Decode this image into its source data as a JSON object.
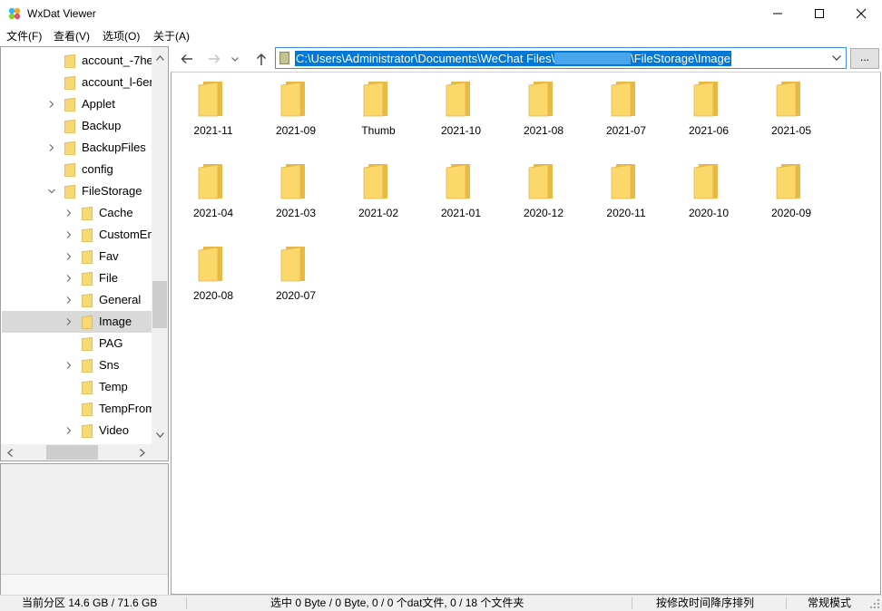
{
  "window": {
    "title": "WxDat Viewer",
    "minimize_icon": "minimize-icon",
    "maximize_icon": "maximize-icon",
    "close_icon": "close-icon"
  },
  "menu": [
    "文件(F)",
    "查看(V)",
    "选项(O)",
    "关于(A)"
  ],
  "tree": {
    "items": [
      {
        "label": "account_-7he",
        "level": 1,
        "expander": "none",
        "selected": false
      },
      {
        "label": "account_l-6er",
        "level": 1,
        "expander": "none",
        "selected": false
      },
      {
        "label": "Applet",
        "level": 1,
        "expander": "collapsed",
        "selected": false
      },
      {
        "label": "Backup",
        "level": 1,
        "expander": "none",
        "selected": false
      },
      {
        "label": "BackupFiles",
        "level": 1,
        "expander": "collapsed",
        "selected": false
      },
      {
        "label": "config",
        "level": 1,
        "expander": "none",
        "selected": false
      },
      {
        "label": "FileStorage",
        "level": 1,
        "expander": "expanded",
        "selected": false
      },
      {
        "label": "Cache",
        "level": 2,
        "expander": "collapsed",
        "selected": false
      },
      {
        "label": "CustomEm",
        "level": 2,
        "expander": "collapsed",
        "selected": false
      },
      {
        "label": "Fav",
        "level": 2,
        "expander": "collapsed",
        "selected": false
      },
      {
        "label": "File",
        "level": 2,
        "expander": "collapsed",
        "selected": false
      },
      {
        "label": "General",
        "level": 2,
        "expander": "collapsed",
        "selected": false
      },
      {
        "label": "Image",
        "level": 2,
        "expander": "collapsed",
        "selected": true
      },
      {
        "label": "PAG",
        "level": 2,
        "expander": "none",
        "selected": false
      },
      {
        "label": "Sns",
        "level": 2,
        "expander": "collapsed",
        "selected": false
      },
      {
        "label": "Temp",
        "level": 2,
        "expander": "none",
        "selected": false
      },
      {
        "label": "TempFrom",
        "level": 2,
        "expander": "none",
        "selected": false
      },
      {
        "label": "Video",
        "level": 2,
        "expander": "collapsed",
        "selected": false
      }
    ]
  },
  "nav": {
    "back_icon": "arrow-left-icon",
    "forward_icon": "arrow-right-icon",
    "recent_icon": "chevron-down-icon",
    "up_icon": "arrow-up-icon"
  },
  "address": {
    "prefix": "C:\\Users\\Administrator\\Documents\\WeChat Files\\",
    "suffix": "\\FileStorage\\Image",
    "more_label": "..."
  },
  "folders": [
    "2021-11",
    "2021-09",
    "Thumb",
    "2021-10",
    "2021-08",
    "2021-07",
    "2021-06",
    "2021-05",
    "2021-04",
    "2021-03",
    "2021-02",
    "2021-01",
    "2020-12",
    "2020-11",
    "2020-10",
    "2020-09",
    "2020-08",
    "2020-07"
  ],
  "status": {
    "partition": "当前分区 14.6 GB / 71.6 GB",
    "selection": "选中 0 Byte / 0 Byte,  0 / 0 个dat文件,  0 / 18 个文件夹",
    "sort": "按修改时间降序排列",
    "mode": "常规模式"
  },
  "colors": {
    "accent": "#0078d7",
    "folder": "#fcd769",
    "selected_row": "#d9d9d9"
  }
}
